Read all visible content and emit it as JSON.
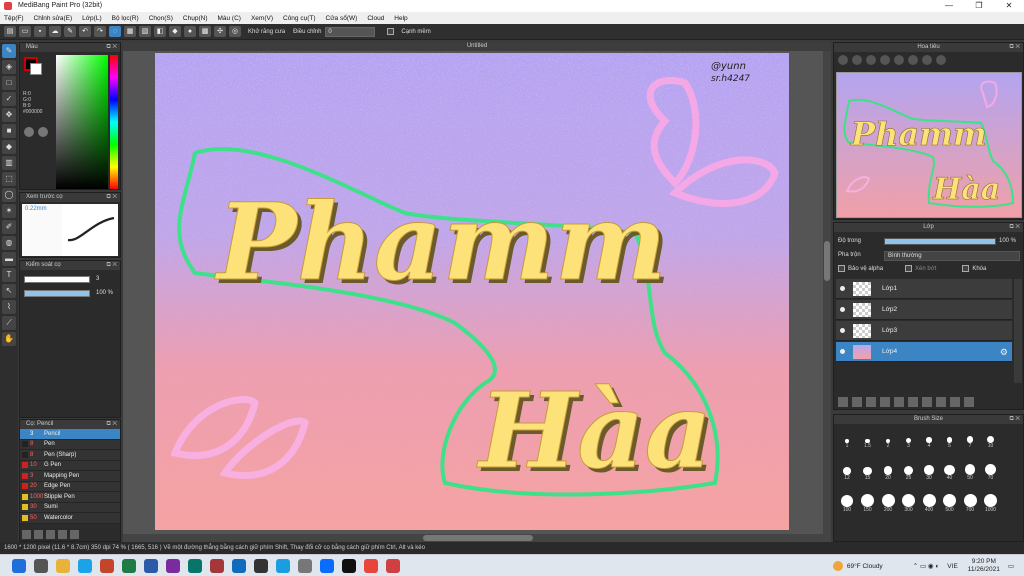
{
  "window": {
    "title": "MediBang Paint Pro (32bit)",
    "controls": [
      "—",
      "❐",
      "✕"
    ]
  },
  "menu": [
    "Tệp(F)",
    "Chỉnh sửa(E)",
    "Lớp(L)",
    "Bộ lọc(R)",
    "Chọn(S)",
    "Chụp(N)",
    "Màu (C)",
    "Xem(V)",
    "Công cụ(T)",
    "Cửa sổ(W)",
    "Cloud",
    "Help"
  ],
  "toolbar": {
    "antialias_label": "Khử răng cưa",
    "adjust_label": "Điều chỉnh",
    "adjust_value": "0",
    "smooth_label": "Cạnh mềm"
  },
  "color_panel": {
    "title": "Màu",
    "rgb": [
      "R:0",
      "G:0",
      "B:0"
    ],
    "hex": "#000000"
  },
  "brush_preview": {
    "title": "Xem trước cọ",
    "size": "0.22mm"
  },
  "brush_control": {
    "title": "Kiểm soát cọ",
    "size_value": "3",
    "opacity_value": "100 %",
    "opacity_fraction": 1.0
  },
  "brush_list": {
    "title": "Cọ: Pencil",
    "items": [
      {
        "size": "3",
        "name": "Pencil",
        "color": "#3b85c4",
        "selected": true
      },
      {
        "size": "8",
        "name": "Pen",
        "color": "#222222",
        "selected": false
      },
      {
        "size": "8",
        "name": "Pen (Sharp)",
        "color": "#222222",
        "selected": false
      },
      {
        "size": "10",
        "name": "G Pen",
        "color": "#d02020",
        "selected": false
      },
      {
        "size": "3",
        "name": "Mapping Pen",
        "color": "#d02020",
        "selected": false
      },
      {
        "size": "20",
        "name": "Edge Pen",
        "color": "#d02020",
        "selected": false
      },
      {
        "size": "1000",
        "name": "Stipple Pen",
        "color": "#e0c020",
        "selected": false
      },
      {
        "size": "30",
        "name": "Sumi",
        "color": "#e0c020",
        "selected": false
      },
      {
        "size": "50",
        "name": "Watercolor",
        "color": "#e0c020",
        "selected": false
      }
    ]
  },
  "canvas": {
    "tab_title": "Untitled",
    "artwork_line1": "Phamm",
    "artwork_line2": "Hàa",
    "signature_line1": "@yunn",
    "signature_line2": "sr.h4247"
  },
  "navigator": {
    "title": "Hoa tiêu",
    "thumb_line1": "Phamm",
    "thumb_line2": "Hàa"
  },
  "layers": {
    "title": "Lớp",
    "opacity_label": "Độ trong",
    "opacity_value": "100 %",
    "opacity_fraction": 1.0,
    "blend_label": "Pha trộn",
    "blend_value": "Bình thường",
    "protect_alpha": "Bảo vệ alpha",
    "clip": "Xén bớt",
    "lock": "Khóa",
    "items": [
      {
        "name": "Lớp1",
        "selected": false
      },
      {
        "name": "Lớp2",
        "selected": false
      },
      {
        "name": "Lớp3",
        "selected": false
      },
      {
        "name": "Lớp4",
        "selected": true
      }
    ]
  },
  "brush_size": {
    "title": "Brush Size",
    "sizes": [
      "1",
      "1.5",
      "2",
      "3",
      "4",
      "5",
      "7",
      "10",
      "12",
      "15",
      "20",
      "25",
      "30",
      "40",
      "50",
      "70",
      "100",
      "150",
      "200",
      "300",
      "400",
      "500",
      "700",
      "1000"
    ]
  },
  "status": {
    "text": "1600 * 1200 pixel   (11.6 * 8.7cm)   350 dpi   74 %   ( 1665, 516 )   Vẽ một đường thẳng bằng cách giữ phím Shift, Thay đổi cỡ cọ bằng cách giữ phím Ctrl, Alt và kéo"
  },
  "taskbar": {
    "weather": "69°F  Cloudy",
    "lang": "VIE",
    "time": "9:20 PM",
    "date": "11/26/2021",
    "apps": [
      {
        "name": "start",
        "color": "#1e6fd9"
      },
      {
        "name": "search",
        "color": "#555555"
      },
      {
        "name": "file-explorer",
        "color": "#e8b33a"
      },
      {
        "name": "skype",
        "color": "#1aa3e8"
      },
      {
        "name": "powerpoint",
        "color": "#c4462a"
      },
      {
        "name": "excel",
        "color": "#1f7a46"
      },
      {
        "name": "word",
        "color": "#2b5aa8"
      },
      {
        "name": "onenote",
        "color": "#7a2b9e"
      },
      {
        "name": "publisher",
        "color": "#077568"
      },
      {
        "name": "access",
        "color": "#a4373a"
      },
      {
        "name": "outlook",
        "color": "#0f6cbd"
      },
      {
        "name": "camera",
        "color": "#333333"
      },
      {
        "name": "edge",
        "color": "#1b9de2"
      },
      {
        "name": "settings",
        "color": "#777777"
      },
      {
        "name": "zalo",
        "color": "#0a6cff"
      },
      {
        "name": "tiktok",
        "color": "#111111"
      },
      {
        "name": "chrome",
        "color": "#e8453c"
      },
      {
        "name": "medibang",
        "color": "#d04040"
      }
    ]
  },
  "colors": {
    "accent": "#3b85c4",
    "letter_fill": "#fde27a",
    "outline": "#3ee08a"
  }
}
